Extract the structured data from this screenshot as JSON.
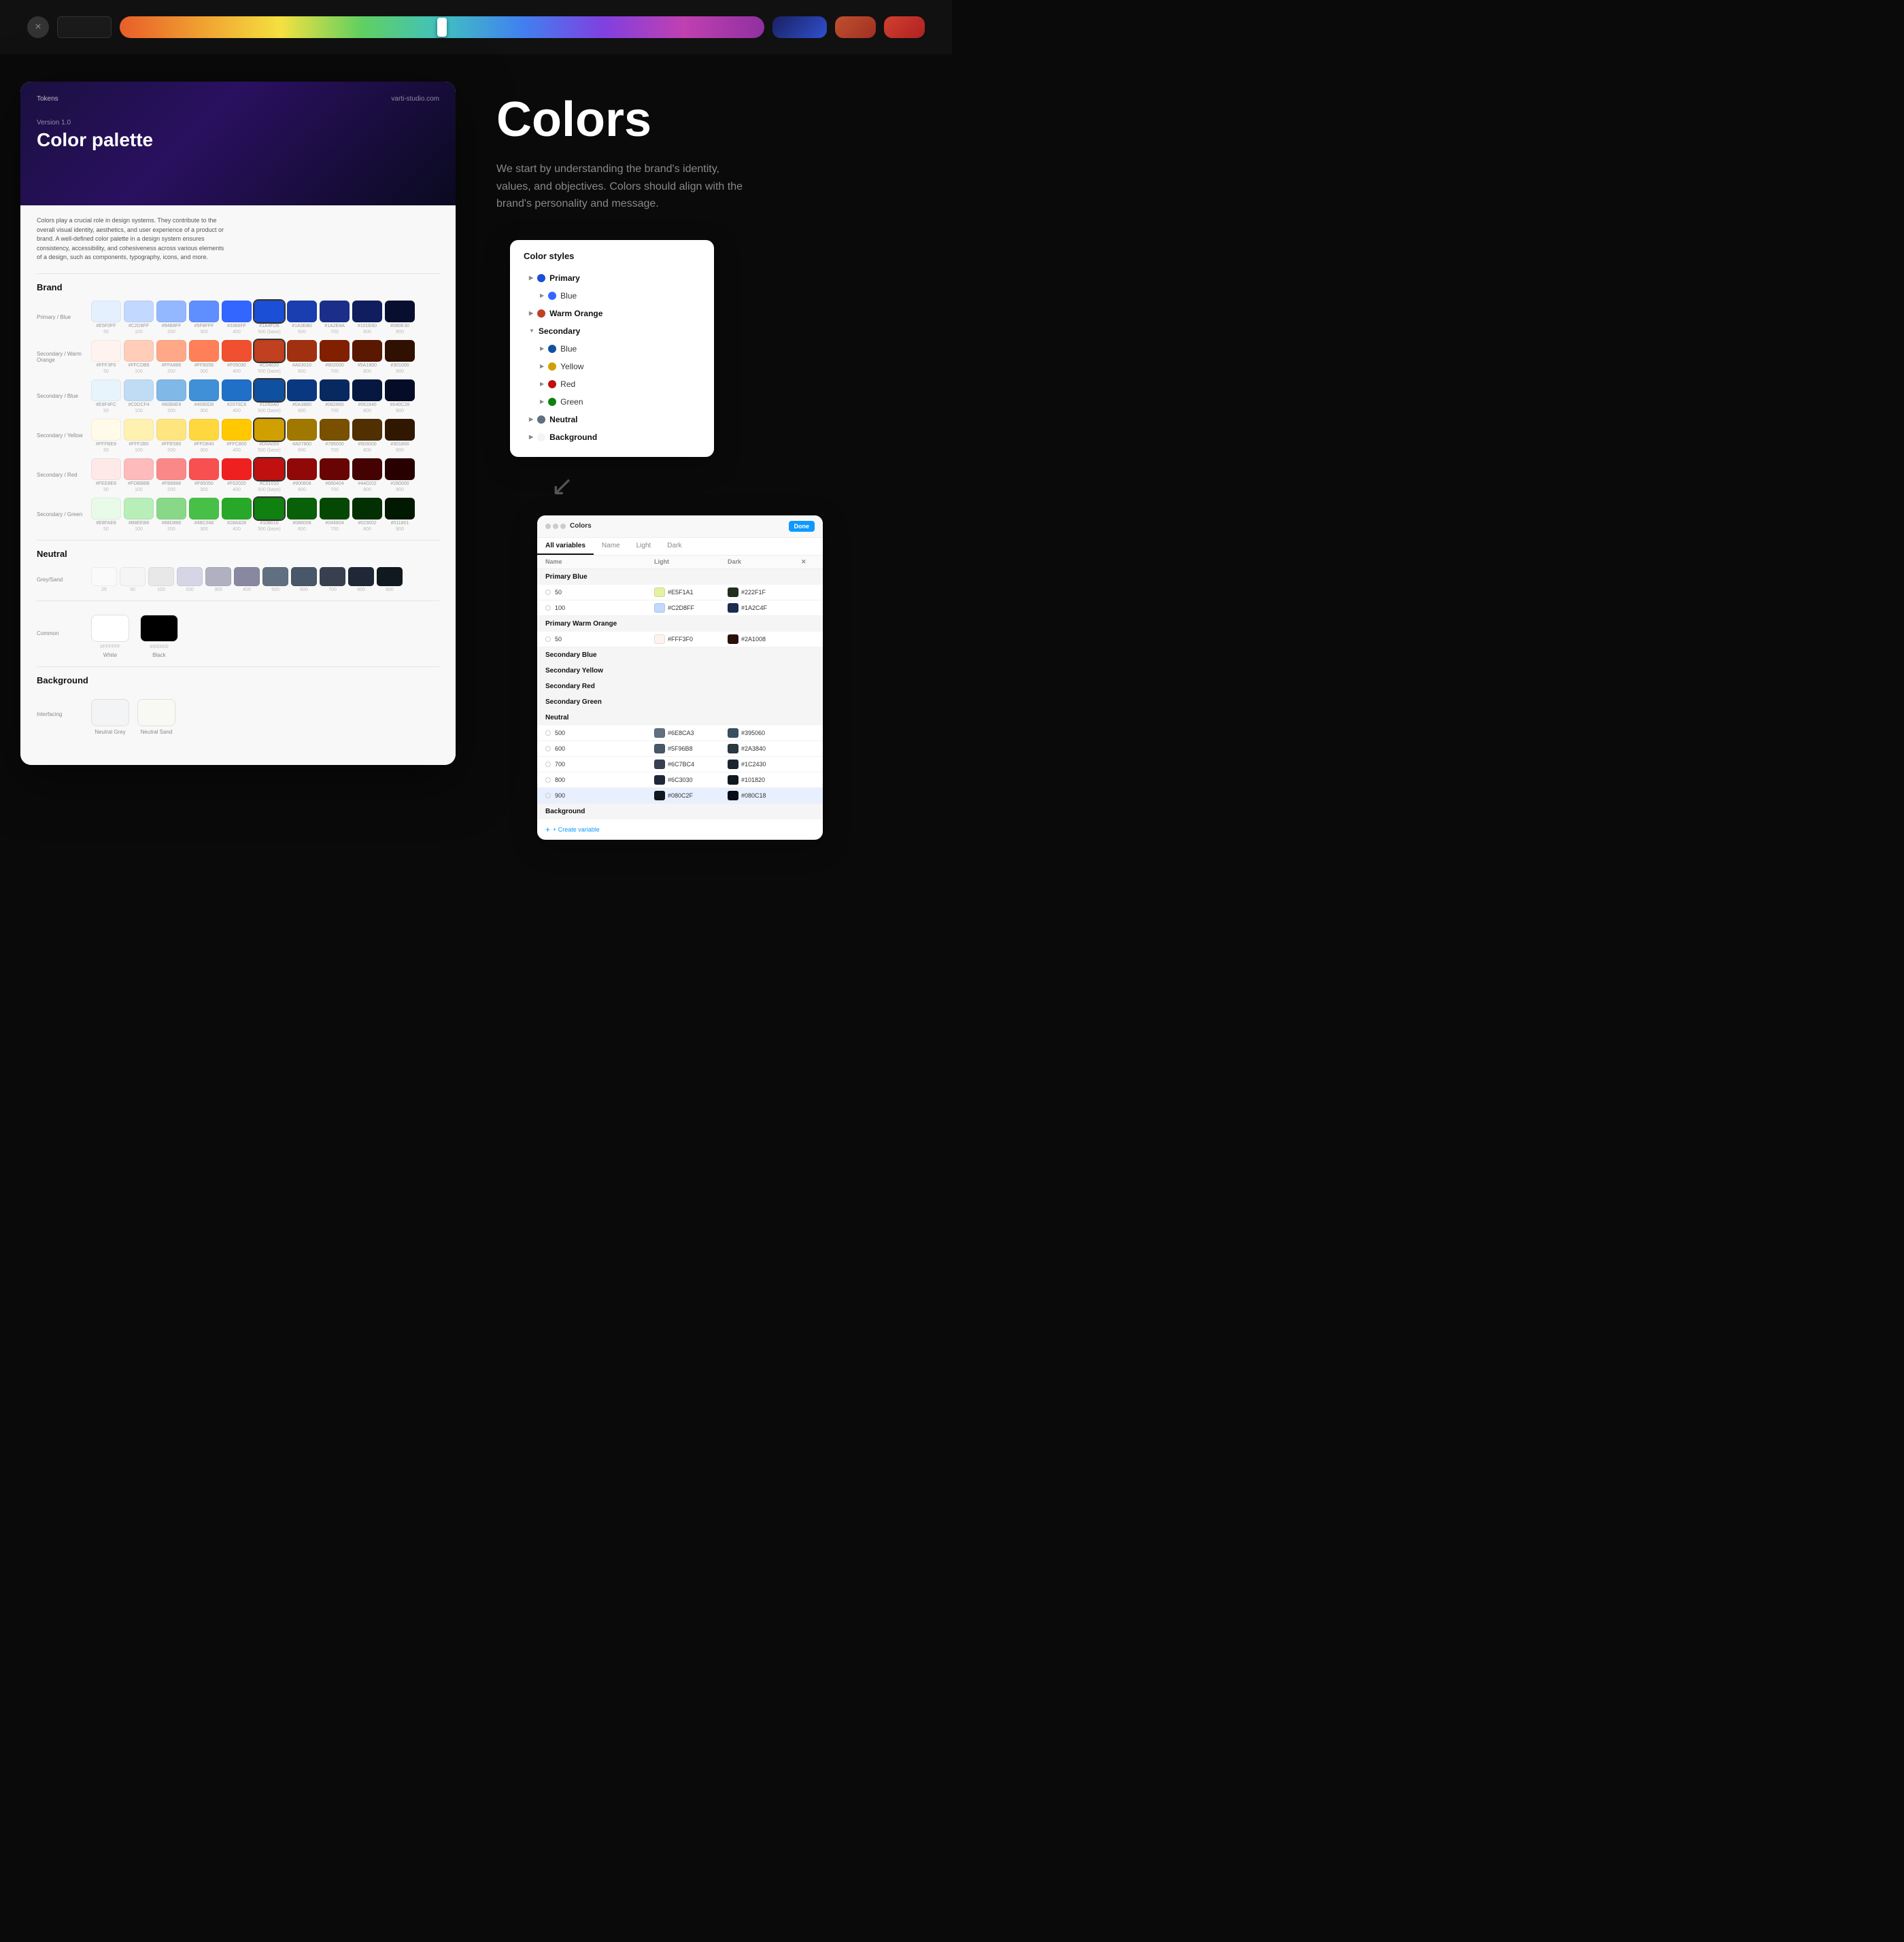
{
  "toolbar": {
    "close_icon": "×",
    "gradient_swatches": [
      {
        "gradient": "linear-gradient(135deg, #1a3080, #2a50d0)",
        "label": "blue-swatch"
      },
      {
        "gradient": "linear-gradient(135deg, #8040c0, #c04080)",
        "label": "purple-pink-swatch"
      },
      {
        "gradient": "linear-gradient(135deg, #e06030, #d04020)",
        "label": "orange-red-swatch"
      }
    ]
  },
  "doc": {
    "tokens_label": "Tokens",
    "url": "varti-studio.com",
    "version": "Version 1.0",
    "title": "Color palette",
    "description": "Colors play a crucial role in design systems. They contribute to the overall visual identity, aesthetics, and user experience of a product or brand. A well-defined color palette in a design system ensures consistency, accessibility, and cohesiveness across various elements of a design, such as components, typography, icons, and more."
  },
  "brand": {
    "section_title": "Brand",
    "rows": [
      {
        "label": "Primary / Blue",
        "swatches": [
          {
            "hex": "#E5F0FF",
            "num": "50"
          },
          {
            "hex": "#C2D8FF",
            "num": "100"
          },
          {
            "hex": "#94B8FF",
            "num": "200"
          },
          {
            "hex": "#5F8FFF",
            "num": "300"
          },
          {
            "hex": "#3366FF",
            "num": "400"
          },
          {
            "hex": "#1A4FD6",
            "num": "500",
            "base": true
          },
          {
            "hex": "#1A3EB0",
            "num": "600"
          },
          {
            "hex": "#1A2E8A",
            "num": "700"
          },
          {
            "hex": "#101E60",
            "num": "800"
          },
          {
            "hex": "#080E30",
            "num": "900"
          }
        ]
      },
      {
        "label": "Secondary / Warm Orange",
        "swatches": [
          {
            "hex": "#FFF3F0",
            "num": "50"
          },
          {
            "hex": "#FFCDB8",
            "num": "100"
          },
          {
            "hex": "#FFA888",
            "num": "200"
          },
          {
            "hex": "#FF8058",
            "num": "300"
          },
          {
            "hex": "#F05030",
            "num": "400"
          },
          {
            "hex": "#C04020",
            "num": "500",
            "base": true
          },
          {
            "hex": "#A03010",
            "num": "600"
          },
          {
            "hex": "#802000",
            "num": "700"
          },
          {
            "hex": "#5A1800",
            "num": "800"
          },
          {
            "hex": "#301000",
            "num": "900"
          }
        ]
      },
      {
        "label": "Secondary / Blue",
        "swatches": [
          {
            "hex": "#E8F4FC",
            "num": "50"
          },
          {
            "hex": "#C0DCF4",
            "num": "100"
          },
          {
            "hex": "#80B8E8",
            "num": "200"
          },
          {
            "hex": "#4090D8",
            "num": "300"
          },
          {
            "hex": "#2070C8",
            "num": "400"
          },
          {
            "hex": "#1050A0",
            "num": "500",
            "base": true
          },
          {
            "hex": "#0A3880",
            "num": "600"
          },
          {
            "hex": "#082860",
            "num": "700"
          },
          {
            "hex": "#061840",
            "num": "800"
          },
          {
            "hex": "#040C28",
            "num": "900"
          }
        ]
      },
      {
        "label": "Secondary / Yellow",
        "swatches": [
          {
            "hex": "#FFFBE8",
            "num": "50"
          },
          {
            "hex": "#FFF2B0",
            "num": "100"
          },
          {
            "hex": "#FFE580",
            "num": "200"
          },
          {
            "hex": "#FFD840",
            "num": "300"
          },
          {
            "hex": "#FFC800",
            "num": "400"
          },
          {
            "hex": "#D0A000",
            "num": "500",
            "base": true
          },
          {
            "hex": "#A07800",
            "num": "600"
          },
          {
            "hex": "#785000",
            "num": "700"
          },
          {
            "hex": "#503000",
            "num": "800"
          },
          {
            "hex": "#301800",
            "num": "900"
          }
        ]
      },
      {
        "label": "Secondary / Red",
        "swatches": [
          {
            "hex": "#FEE8E8",
            "num": "50"
          },
          {
            "hex": "#FDBBBB",
            "num": "100"
          },
          {
            "hex": "#FB8888",
            "num": "200"
          },
          {
            "hex": "#F85050",
            "num": "300"
          },
          {
            "hex": "#F02020",
            "num": "400"
          },
          {
            "hex": "#C01010",
            "num": "500",
            "base": true
          },
          {
            "hex": "#900808",
            "num": "600"
          },
          {
            "hex": "#680404",
            "num": "700"
          },
          {
            "hex": "#440202",
            "num": "800"
          },
          {
            "hex": "#280000",
            "num": "900"
          }
        ]
      },
      {
        "label": "Secondary / Green",
        "swatches": [
          {
            "hex": "#E8FAE8",
            "num": "50"
          },
          {
            "hex": "#B8EEB8",
            "num": "100"
          },
          {
            "hex": "#88D888",
            "num": "200"
          },
          {
            "hex": "#48C048",
            "num": "300"
          },
          {
            "hex": "#28A828",
            "num": "400"
          },
          {
            "hex": "#108010",
            "num": "500",
            "base": true
          },
          {
            "hex": "#086008",
            "num": "600"
          },
          {
            "hex": "#044804",
            "num": "700"
          },
          {
            "hex": "#023002",
            "num": "800"
          },
          {
            "hex": "#011801",
            "num": "900"
          }
        ]
      }
    ]
  },
  "neutral": {
    "section_title": "Neutral",
    "grey_label": "Grey/Sand",
    "swatches": [
      {
        "hex": "#FAFAFA",
        "num": "25"
      },
      {
        "hex": "#F5F5F5",
        "num": "50"
      },
      {
        "hex": "#E8E8E8",
        "num": "100"
      },
      {
        "hex": "#D5D5E5",
        "num": "200"
      },
      {
        "hex": "#B0B0C0",
        "num": "300"
      },
      {
        "hex": "#8888A0",
        "num": "400"
      },
      {
        "hex": "#607080",
        "num": "500",
        "base": true
      },
      {
        "hex": "#485868",
        "num": "600"
      },
      {
        "hex": "#384050",
        "num": "700"
      },
      {
        "hex": "#202838",
        "num": "800"
      },
      {
        "hex": "#101820",
        "num": "900"
      }
    ],
    "common_label": "Common",
    "white": {
      "hex": "#FFFFFF",
      "label": "White"
    },
    "black": {
      "hex": "#000000",
      "label": "Black"
    }
  },
  "background": {
    "section_title": "Background",
    "interfacing_label": "Interfacing",
    "swatches": [
      {
        "hex": "#F3F4F6",
        "label": "Neutral Grey"
      },
      {
        "hex": "#F8F9F3",
        "label": "Neutral Sand"
      }
    ]
  },
  "right": {
    "heading": "Colors",
    "description": "We start by understanding the brand's identity, values, and objectives. Colors should align with the brand's personality and message."
  },
  "color_styles_panel": {
    "title": "Color styles",
    "items": [
      {
        "type": "group",
        "label": "Primary",
        "expanded": false,
        "dot_color": "#1A4FD6"
      },
      {
        "type": "child",
        "label": "Blue",
        "dot_color": "#3366FF"
      },
      {
        "type": "group",
        "label": "Warm Orange",
        "expanded": false,
        "dot_color": "#C04020"
      },
      {
        "type": "group_secondary",
        "label": "Secondary",
        "expanded": true,
        "dot_color": null
      },
      {
        "type": "child",
        "label": "Blue",
        "dot_color": "#1050A0"
      },
      {
        "type": "child",
        "label": "Yellow",
        "dot_color": "#D0A000"
      },
      {
        "type": "child",
        "label": "Red",
        "dot_color": "#C01010"
      },
      {
        "type": "child",
        "label": "Green",
        "dot_color": "#108010"
      },
      {
        "type": "group",
        "label": "Neutral",
        "expanded": false,
        "dot_color": "#607080"
      },
      {
        "type": "group",
        "label": "Background",
        "expanded": false,
        "dot_color": "#F3F4F6"
      }
    ]
  },
  "variables_panel": {
    "title": "Colors",
    "done_label": "Done",
    "tabs": [
      "All variables",
      "Name",
      "Light",
      "Dark"
    ],
    "active_tab": "All variables",
    "groups": [
      {
        "label": "Primary Blue",
        "rows": [
          {
            "name": "50",
            "light_color": "#E5F1A1",
            "light_hex": "#E5F1A1",
            "dark_color": "#222F1F",
            "dark_hex": "#222F1F"
          },
          {
            "name": "100",
            "light_color": "#C2D8FF",
            "light_hex": "#C2D8FF",
            "dark_color": "#1A2C4F",
            "dark_hex": "#1A2C4F"
          }
        ]
      },
      {
        "label": "Primary Warm Orange",
        "rows": [
          {
            "name": "50",
            "light_color": "#FFF3F0",
            "light_hex": "#FFF3F0",
            "dark_color": "#2A1008",
            "dark_hex": "#2A1008"
          }
        ]
      },
      {
        "label": "Secondary Blue",
        "rows": []
      },
      {
        "label": "Secondary Yellow",
        "rows": []
      },
      {
        "label": "Secondary Red",
        "rows": []
      },
      {
        "label": "Secondary Green",
        "rows": []
      },
      {
        "label": "Neutral",
        "rows": [
          {
            "name": "500",
            "light_color": "#607080",
            "light_hex": "#6E8CA3",
            "dark_color": "#395060",
            "dark_hex": "#395060"
          },
          {
            "name": "600",
            "light_color": "#485868",
            "light_hex": "#5F96B8",
            "dark_color": "#2A3840",
            "dark_hex": "#2A3840"
          },
          {
            "name": "700",
            "light_color": "#384050",
            "light_hex": "#6C7BC4",
            "dark_color": "#1C2430",
            "dark_hex": "#1C2430"
          },
          {
            "name": "800",
            "light_color": "#202838",
            "light_hex": "#6C3030",
            "dark_color": "#101820",
            "dark_hex": "#101820"
          },
          {
            "name": "900",
            "light_color": "#101820",
            "light_hex": "#080C2F",
            "dark_color": "#080C18",
            "dark_hex": "#080C18",
            "selected": true
          }
        ]
      },
      {
        "label": "Background",
        "rows": []
      }
    ],
    "create_variable_label": "+ Create variable"
  }
}
